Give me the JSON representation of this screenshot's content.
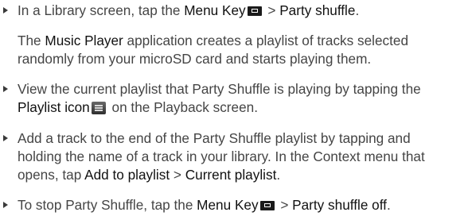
{
  "items": [
    {
      "l1_a": "In a Library screen, tap the ",
      "l1_b": "Menu Key",
      "l1_c": " > ",
      "l1_d": "Party shuffle",
      "l1_e": "."
    },
    {
      "l1": "The ",
      "l1_b": "Music Player",
      "l1_c": " application creates a playlist of tracks selected",
      "l2": "randomly from your microSD card and starts playing them."
    },
    {
      "l1": "View the current playlist that Party Shuffle is playing by tapping the",
      "l2_a": "Playlist icon",
      "l2_b": " on the Playback screen."
    },
    {
      "l1": "Add a track to the end of the Party Shuffle playlist by tapping and",
      "l2": "holding the name of a track in your library. In the Context menu that",
      "l3_a": "opens, tap ",
      "l3_b": "Add to playlist",
      "l3_c": " > ",
      "l3_d": "Current playlist",
      "l3_e": "."
    },
    {
      "l1_a": "To stop Party Shuffle, tap the ",
      "l1_b": "Menu Key",
      "l1_c": " > ",
      "l1_d": "Party shuffle off",
      "l1_e": "."
    }
  ],
  "icons": {
    "menu_key": "menu-key-icon",
    "playlist": "playlist-icon"
  }
}
